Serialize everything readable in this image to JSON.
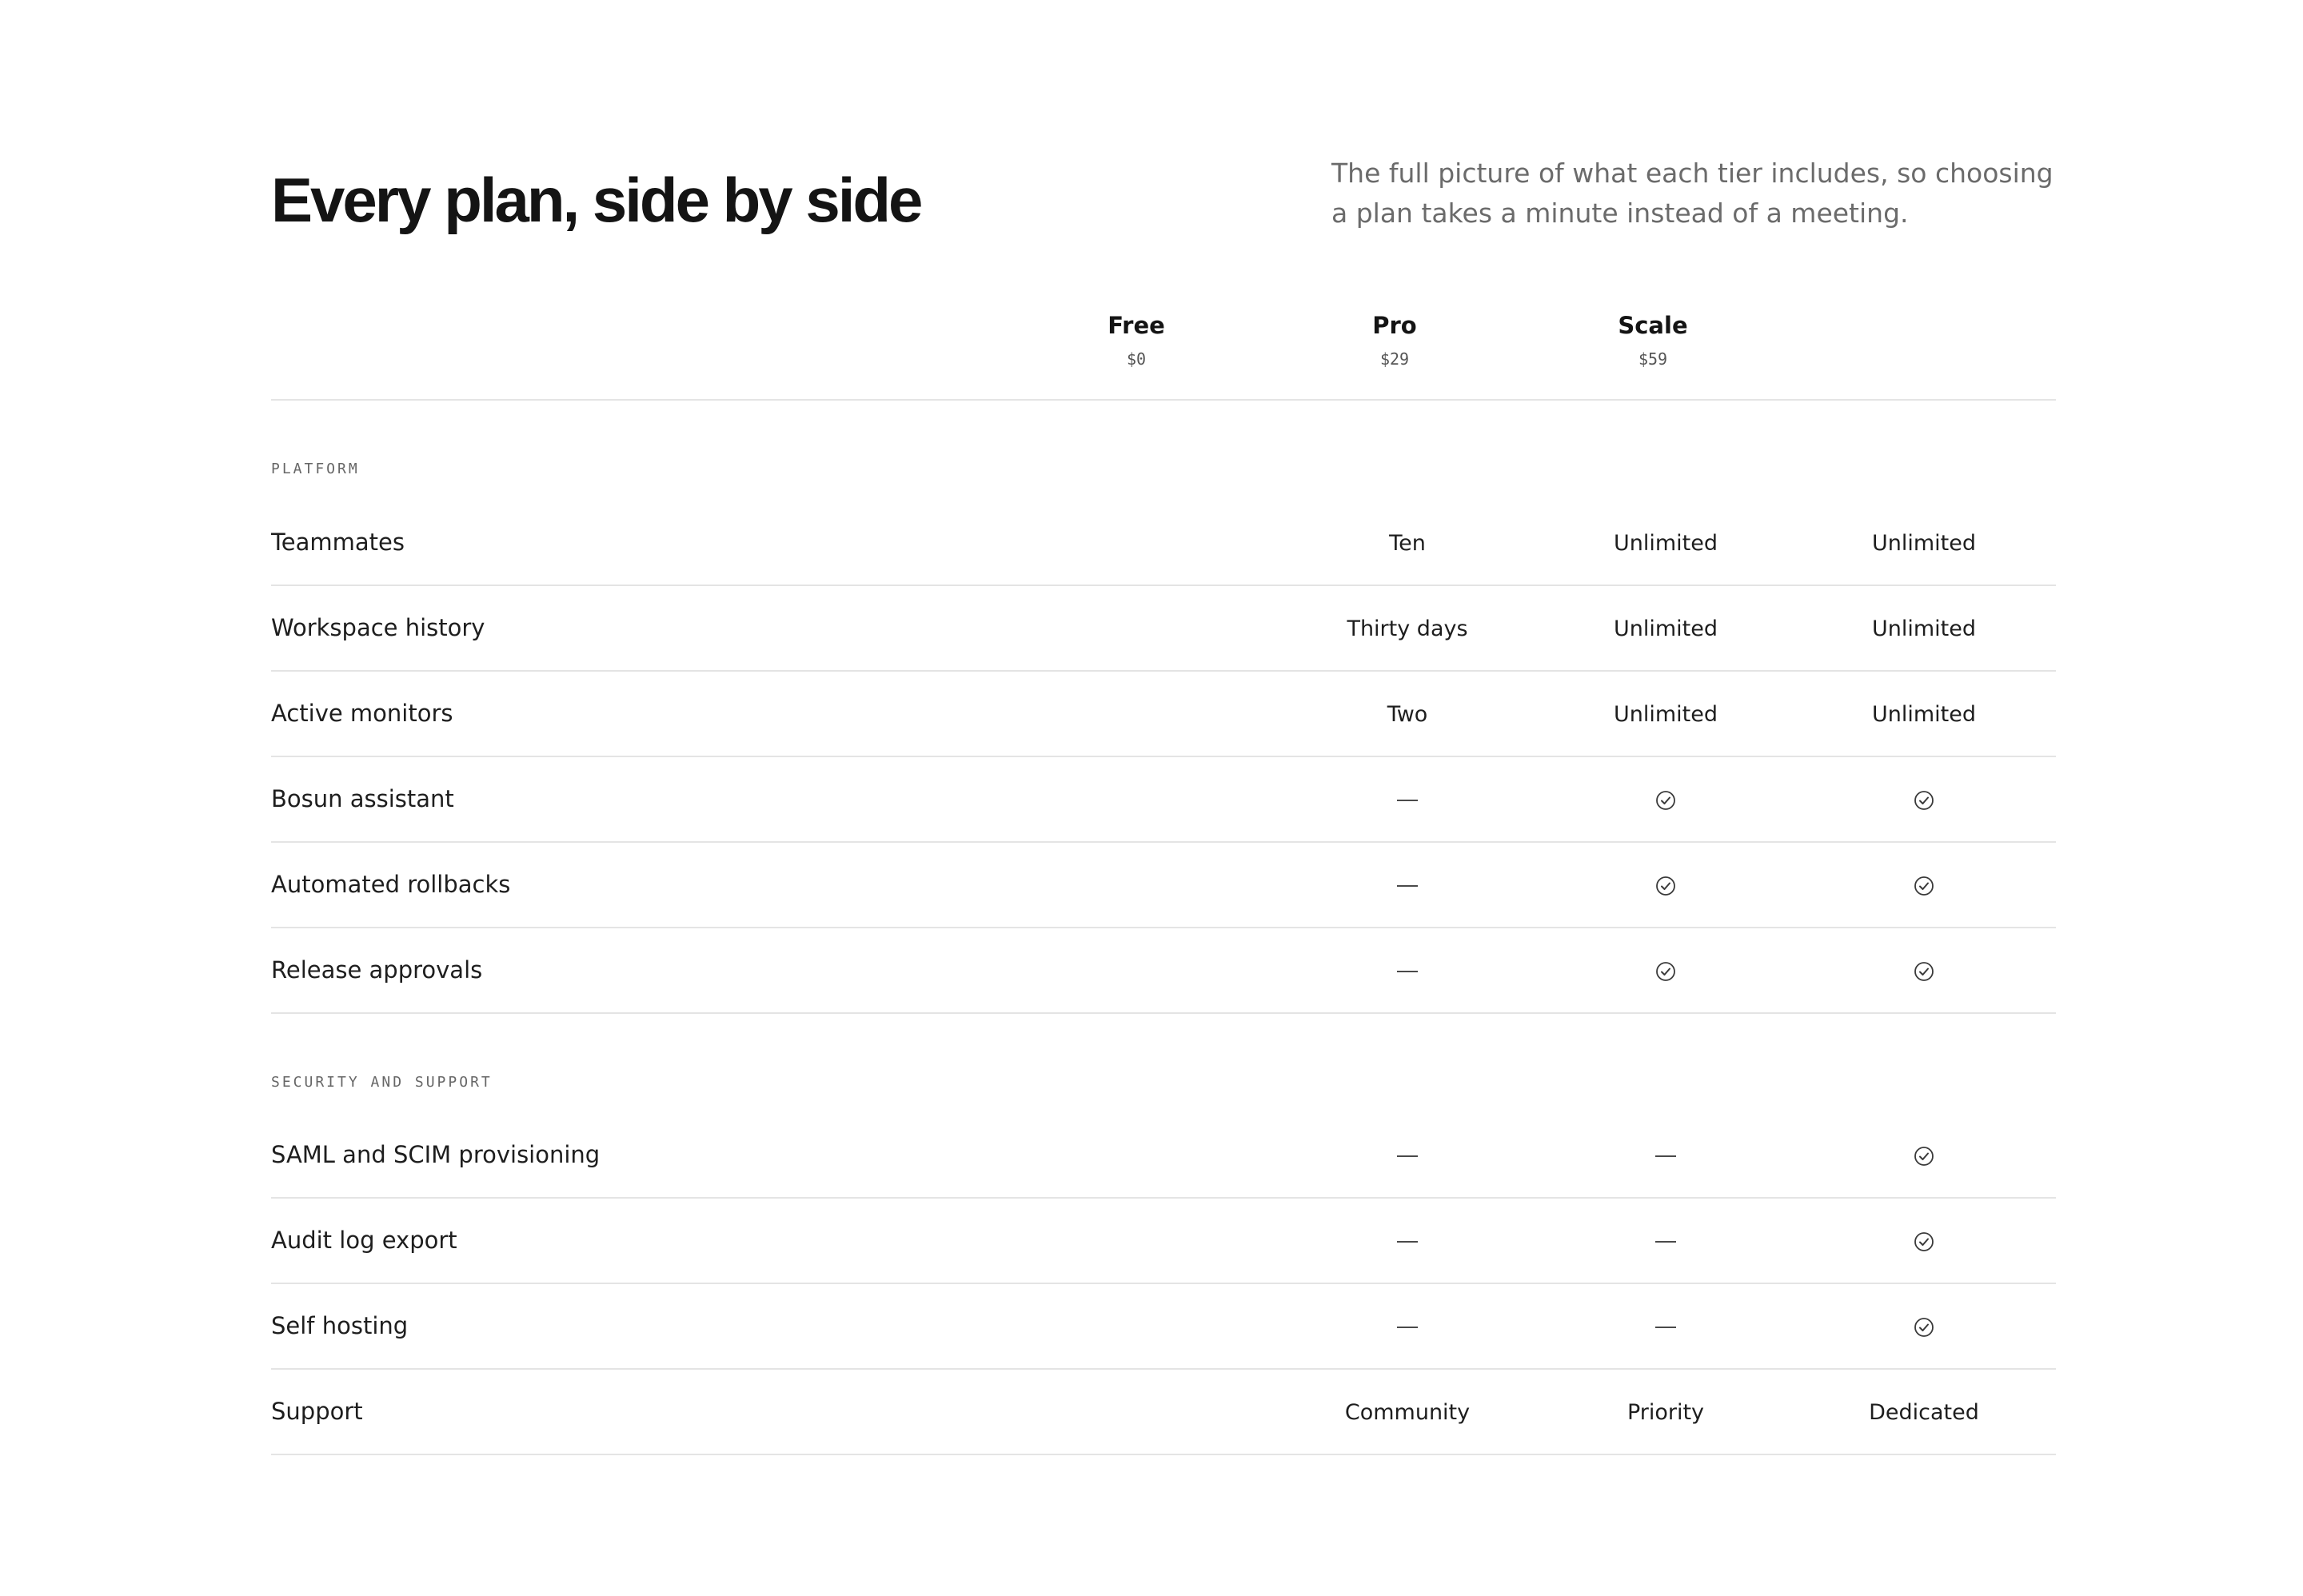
{
  "header": {
    "title": "Every plan, side by side",
    "subtitle": "The full picture of what each tier includes, so choosing a plan takes a minute instead of a meeting."
  },
  "plans": [
    {
      "name": "Free",
      "price": "$0"
    },
    {
      "name": "Pro",
      "price": "$29"
    },
    {
      "name": "Scale",
      "price": "$59"
    }
  ],
  "sections": [
    {
      "label": "PLATFORM",
      "rows": [
        {
          "feature": "Teammates",
          "values": [
            "Ten",
            "Unlimited",
            "Unlimited"
          ]
        },
        {
          "feature": "Workspace history",
          "values": [
            "Thirty days",
            "Unlimited",
            "Unlimited"
          ]
        },
        {
          "feature": "Active monitors",
          "values": [
            "Two",
            "Unlimited",
            "Unlimited"
          ]
        },
        {
          "feature": "Bosun assistant",
          "values": [
            "no",
            "yes",
            "yes"
          ]
        },
        {
          "feature": "Automated rollbacks",
          "values": [
            "no",
            "yes",
            "yes"
          ]
        },
        {
          "feature": "Release approvals",
          "values": [
            "no",
            "yes",
            "yes"
          ]
        }
      ]
    },
    {
      "label": "SECURITY AND SUPPORT",
      "rows": [
        {
          "feature": "SAML and SCIM provisioning",
          "values": [
            "no",
            "no",
            "yes"
          ]
        },
        {
          "feature": "Audit log export",
          "values": [
            "no",
            "no",
            "yes"
          ]
        },
        {
          "feature": "Self hosting",
          "values": [
            "no",
            "no",
            "yes"
          ]
        },
        {
          "feature": "Support",
          "values": [
            "Community",
            "Priority",
            "Dedicated"
          ]
        }
      ]
    }
  ],
  "icons": {
    "yes": "check-circle-icon",
    "no": "dash-icon"
  },
  "colors": {
    "text": "#1e1e1e",
    "muted": "#6b6b6b",
    "divider": "#e4e4e4"
  }
}
